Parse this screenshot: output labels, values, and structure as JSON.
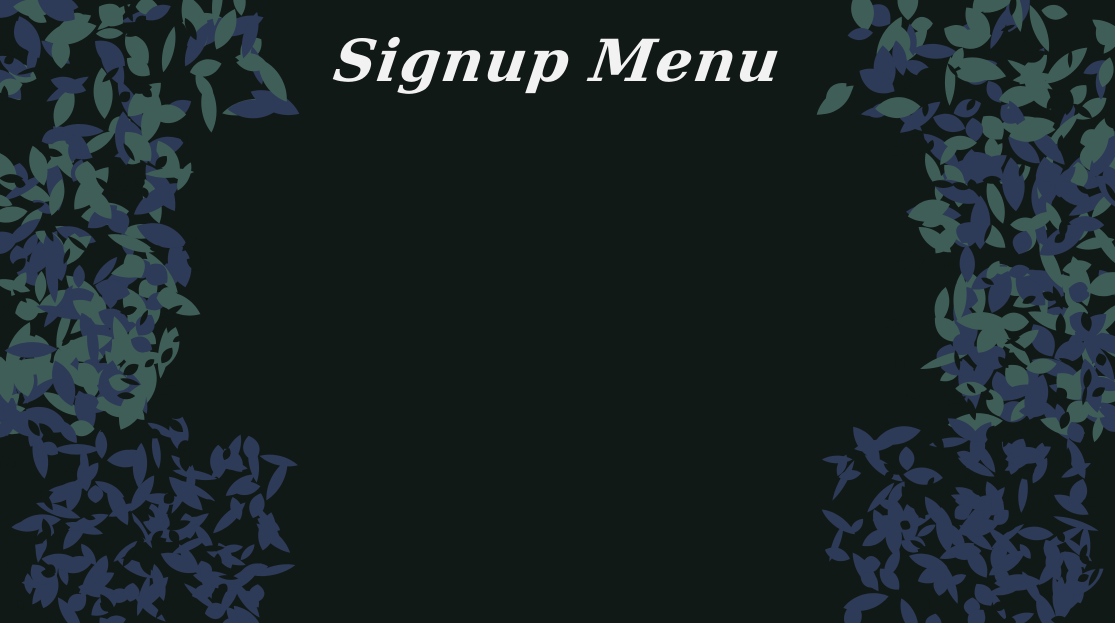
{
  "menu": {
    "title": "Signup Menu"
  },
  "colors": {
    "background": "#111916",
    "title_text": "#f2f2f2",
    "leaf_teal": "#3f5e58",
    "leaf_navy": "#2d3a58"
  },
  "decoration": {
    "left_panel": "leaf-foliage",
    "right_panel": "leaf-foliage"
  }
}
